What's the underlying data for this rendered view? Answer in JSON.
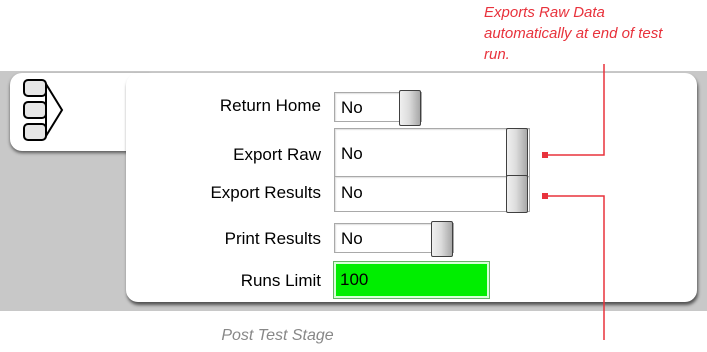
{
  "callout": {
    "text": "Exports Raw Data automatically at end of test run.",
    "color": "#e8323c"
  },
  "stage_icon": "stage-stack-arrow-icon",
  "rows": [
    {
      "label": "Return Home",
      "value": "No",
      "control": "toggle"
    },
    {
      "label": "Export Raw",
      "value": "No",
      "control": "toggle"
    },
    {
      "label": "Export Results",
      "value": "No",
      "control": "toggle"
    },
    {
      "label": "Print Results",
      "value": "No",
      "control": "toggle"
    },
    {
      "label": "Runs Limit",
      "value": "100",
      "control": "number",
      "background": "#00ee00"
    }
  ],
  "caption": "Post Test Stage"
}
